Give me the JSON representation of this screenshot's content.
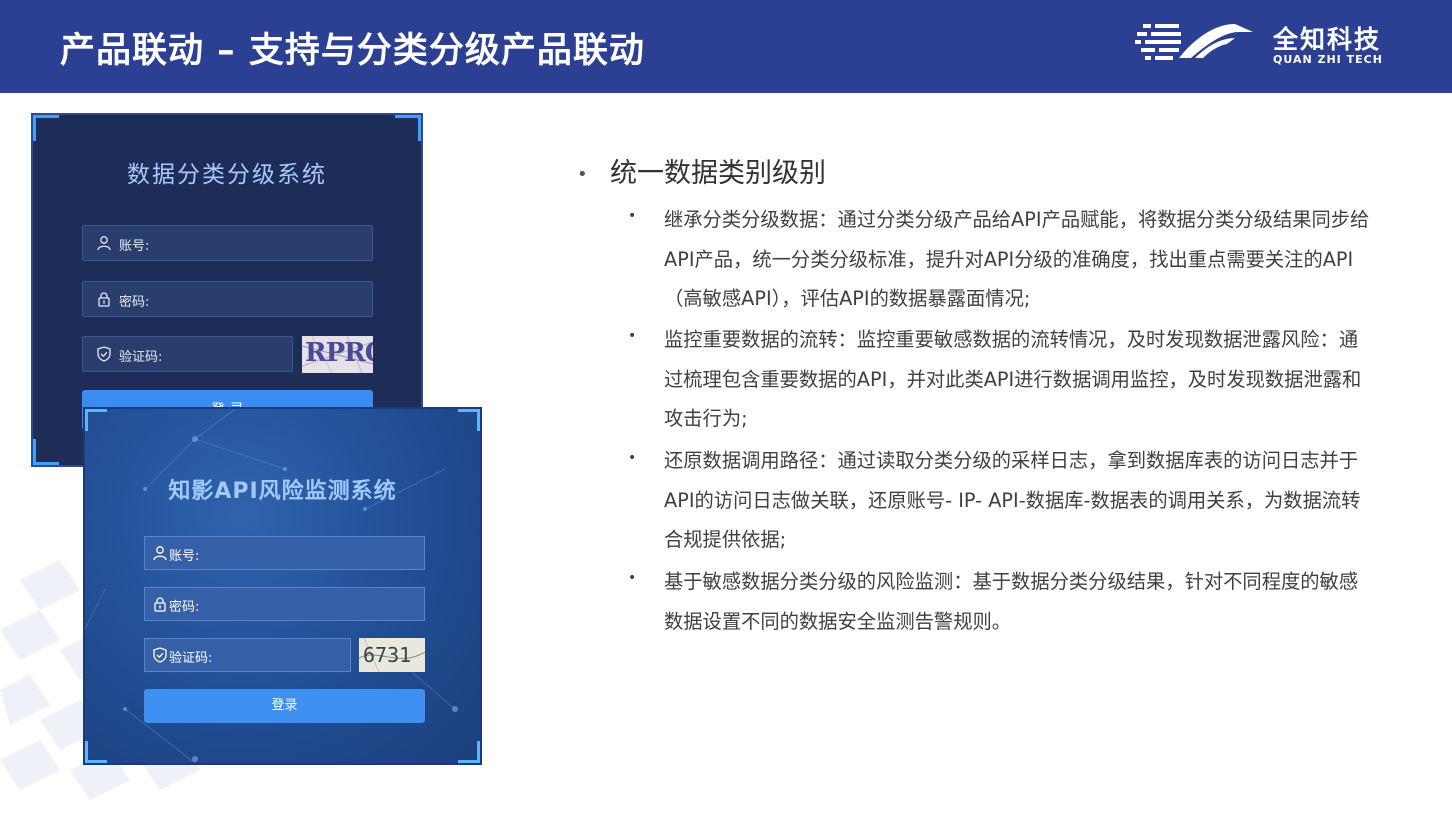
{
  "header": {
    "title": "产品联动 – 支持与分类分级产品联动",
    "logo_cn": "全知科技",
    "logo_en": "QUAN ZHI TECH"
  },
  "login_window_1": {
    "title": "数据分类分级系统",
    "account_label": "账号:",
    "password_label": "密码:",
    "captcha_label": "验证码:",
    "captcha_text": "RPRQ",
    "login_button": "登 录"
  },
  "login_window_2": {
    "title": "知影API风险监测系统",
    "account_label": "账号:",
    "password_label": "密码:",
    "captcha_label": "验证码:",
    "captcha_text": "6731",
    "login_button": "登录"
  },
  "content": {
    "main_heading": "统一数据类别级别",
    "bullets": [
      "继承分类分级数据：通过分类分级产品给API产品赋能，将数据分类分级结果同步给API产品，统一分类分级标准，提升对API分级的准确度，找出重点需要关注的API（高敏感API），评估API的数据暴露面情况;",
      "监控重要数据的流转：监控重要敏感数据的流转情况，及时发现数据泄露风险：通过梳理包含重要数据的API，并对此类API进行数据调用监控，及时发现数据泄露和攻击行为;",
      "还原数据调用路径：通过读取分类分级的采样日志，拿到数据库表的访问日志并于API的访问日志做关联，还原账号- IP- API-数据库-数据表的调用关系，为数据流转合规提供依据;",
      "基于敏感数据分类分级的风险监测：基于数据分类分级结果，针对不同程度的敏感数据设置不同的数据安全监测告警规则。"
    ]
  },
  "colors": {
    "header_bg": "#2b3f93",
    "accent_blue": "#3b8cf2",
    "login1_bg": "#1d2d57",
    "login2_bg": "#214d93"
  }
}
